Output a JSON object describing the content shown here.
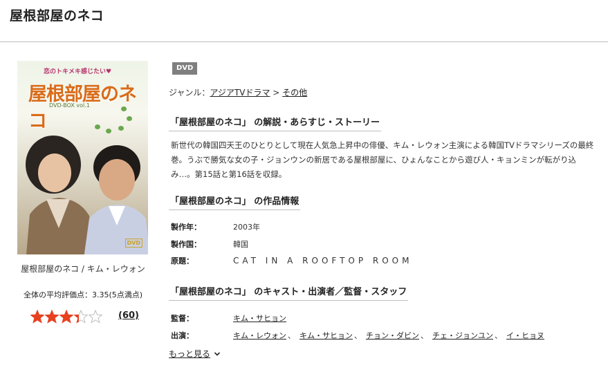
{
  "page": {
    "title": "屋根部屋のネコ"
  },
  "cover": {
    "tagline": "恋のトキメキ感じたい♥",
    "title": "屋根部屋のネコ",
    "subtitle": "DVD-BOX vol.1",
    "logo": "DVD",
    "caption": "屋根部屋のネコ / キム・レウォン"
  },
  "rating": {
    "label": "全体の平均評価点：3.35(5点満点)",
    "value": 3.35,
    "max": 5,
    "count_text": "(60)",
    "star_color": "#e8411f"
  },
  "product": {
    "badge": "DVD",
    "genre_label": "ジャンル：",
    "genre_items": [
      "アジアTVドラマ",
      "その他"
    ],
    "genre_separator": " > "
  },
  "sections": {
    "synopsis_heading": "「屋根部屋のネコ」 の解説・あらすじ・ストーリー",
    "synopsis_text": "新世代の韓国四天王のひとりとして現在人気急上昇中の俳優、キム・レウォン主演による韓国TVドラマシリーズの最終巻。うぶで勝気な女の子・ジョンウンの新居である屋根部屋に、ひょんなことから遊び人・キョンミンが転がり込み…。第15話と第16話を収録。",
    "info_heading": "「屋根部屋のネコ」 の作品情報",
    "info": [
      {
        "key": "製作年：",
        "value": "2003年"
      },
      {
        "key": "製作国：",
        "value": "韓国"
      },
      {
        "key": "原題：",
        "value": "CAT IN A ROOFTOP ROOM"
      }
    ],
    "cast_heading": "「屋根部屋のネコ」 のキャスト・出演者／監督・スタッフ",
    "director_key": "監督：",
    "director": "キム・サヒョン",
    "cast_key": "出演：",
    "cast": [
      "キム・レウォン",
      "キム・サヒョン",
      "チョン・ダビン",
      "チェ・ジョンユン",
      "イ・ヒョヌ"
    ],
    "cast_separator": "、",
    "more_label": "もっと見る"
  }
}
